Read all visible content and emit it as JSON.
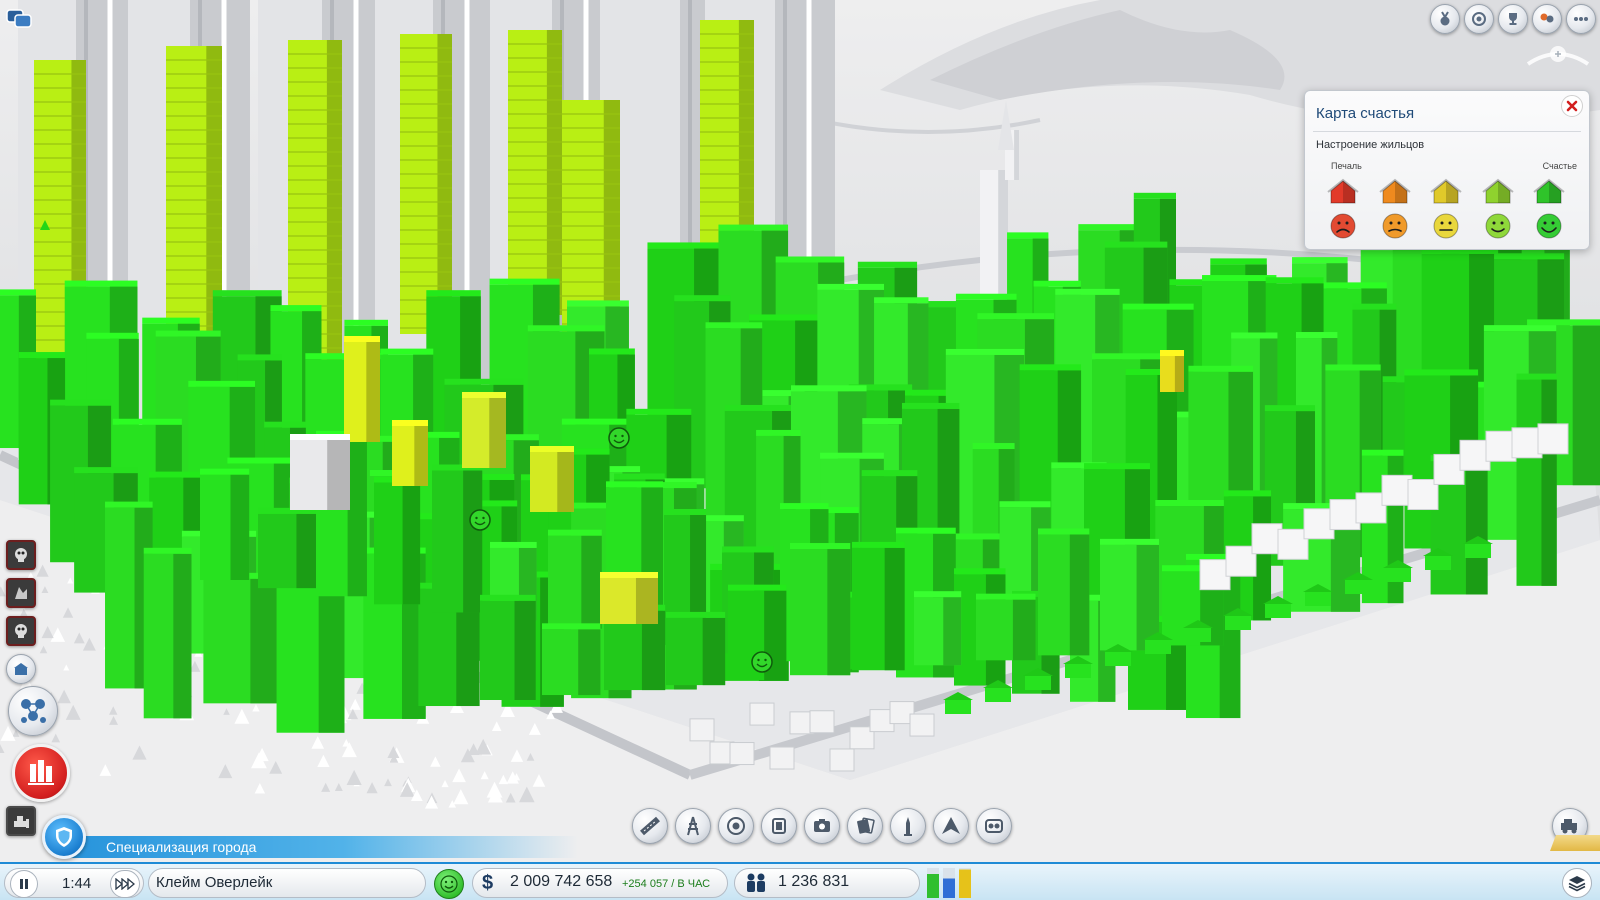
{
  "panel": {
    "title": "Карта счастья",
    "subtitle": "Настроение жильцов",
    "label_sad": "Печаль",
    "label_happy": "Счастье",
    "legend_levels": [
      {
        "name": "very-sad",
        "house_color": "#e23a2a",
        "face_color": "#e24a32"
      },
      {
        "name": "sad",
        "house_color": "#ef8a1e",
        "face_color": "#f09a2a"
      },
      {
        "name": "neutral",
        "house_color": "#e0c92a",
        "face_color": "#e9d73c"
      },
      {
        "name": "happy",
        "house_color": "#8fd22e",
        "face_color": "#8fd83a"
      },
      {
        "name": "very-happy",
        "house_color": "#2fc42a",
        "face_color": "#35cc35"
      }
    ]
  },
  "specialization": {
    "label": "Специализация города"
  },
  "status": {
    "time": "1:44",
    "city_name": "Клейм Оверлейк",
    "money_icon": "$",
    "money": "2 009 742 658",
    "money_rate": "+254 057 / В ЧАС",
    "population": "1 236 831"
  },
  "demand": {
    "residential": 0.8,
    "commercial": 0.65,
    "industrial": 0.95
  },
  "colors": {
    "accent_blue": "#1f8bd6",
    "happy_green": "#27e21f",
    "yellow_green": "#b9ef14",
    "yellow": "#e8dd1d",
    "ground": "#dcdde0"
  },
  "icons": {
    "chat": "chat-bubbles-icon",
    "top_right": [
      "medal-icon",
      "sim-icon",
      "trophy-icon",
      "friends-icon",
      "menu-icon"
    ],
    "left_toolbar": [
      "disaster-icon",
      "zombie-icon",
      "disaster-icon",
      "city-hall-icon",
      "regions-icon",
      "zone-map-icon",
      "bulldoze-icon"
    ],
    "bottom_tools": [
      "road-icon",
      "power-icon",
      "water-icon",
      "fire-icon",
      "photo-icon",
      "health-icon",
      "education-icon",
      "transport-icon",
      "parks-icon"
    ]
  }
}
